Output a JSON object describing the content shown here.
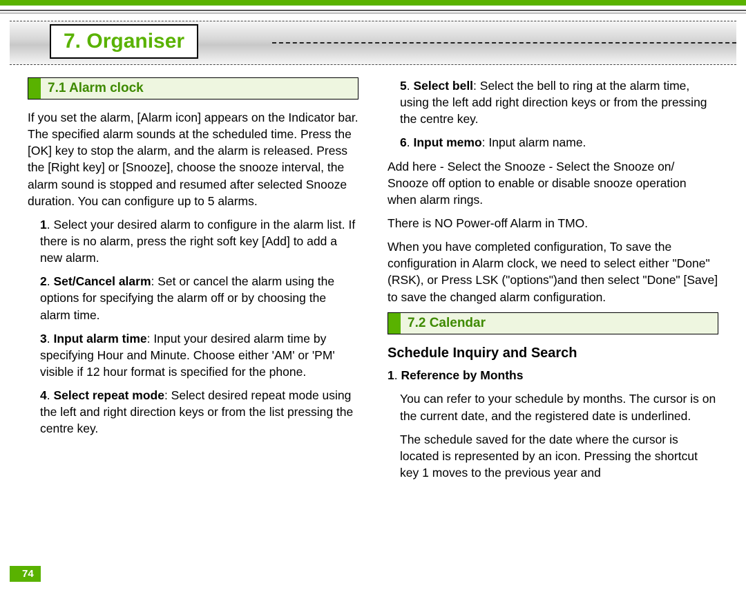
{
  "chapter": "7. Organiser",
  "page_number": "74",
  "section71": {
    "title": "7.1 Alarm clock",
    "intro": "If you set the alarm, [Alarm icon] appears on the Indicator bar. The specified alarm sounds at the scheduled time. Press the [OK] key to stop the alarm, and the alarm is released. Press the [Right key] or [Snooze], choose the snooze interval, the alarm sound is stopped and resumed after selected Snooze duration. You can configure up to 5 alarms.",
    "item1_num": "1",
    "item1_body": "Select your desired alarm to configure in the alarm list. If there is no alarm, press the right soft key [Add] to add a new alarm.",
    "item2_num": "2",
    "item2_label": "Set/Cancel alarm",
    "item2_body": ": Set or cancel the alarm using the options for specifying the alarm off or by choosing the alarm time.",
    "item3_num": "3",
    "item3_label": "Input alarm time",
    "item3_body": ": Input your desired alarm time by specifying Hour and Minute. Choose either 'AM' or 'PM' visible if 12 hour format is specified for the phone.",
    "item4_num": "4",
    "item4_label": "Select repeat mode",
    "item4_body": ": Select desired repeat mode using the left and right direction keys or from the list pressing the centre key.",
    "item5_num": "5",
    "item5_label": "Select bell",
    "item5_body": ": Select the bell to ring at the alarm time, using the left add right direction keys or from the pressing the centre key.",
    "item6_num": "6",
    "item6_label": "Input memo",
    "item6_body": ": Input alarm name.",
    "addhere": "Add here - Select the Snooze - Select the Snooze on/ Snooze off option to enable or disable snooze operation when alarm rings.",
    "poweroff": "There is NO Power-off Alarm in TMO.",
    "save": "When you have completed configuration, To save the configuration in Alarm clock, we need to select either \"Done\" (RSK), or Press LSK (\"options\")and then select \"Done\"  [Save] to save the changed alarm configuration."
  },
  "section72": {
    "title": "7.2 Calendar",
    "subsection": "Schedule Inquiry and Search",
    "ref_num": "1",
    "ref_label": "Reference by Months",
    "ref_body1": "You can refer to your schedule by months. The cursor is on the current date, and the registered date is underlined.",
    "ref_body2": "The schedule saved for the date where the cursor is located is represented by an icon. Pressing the shortcut key 1 moves to the previous year and"
  }
}
